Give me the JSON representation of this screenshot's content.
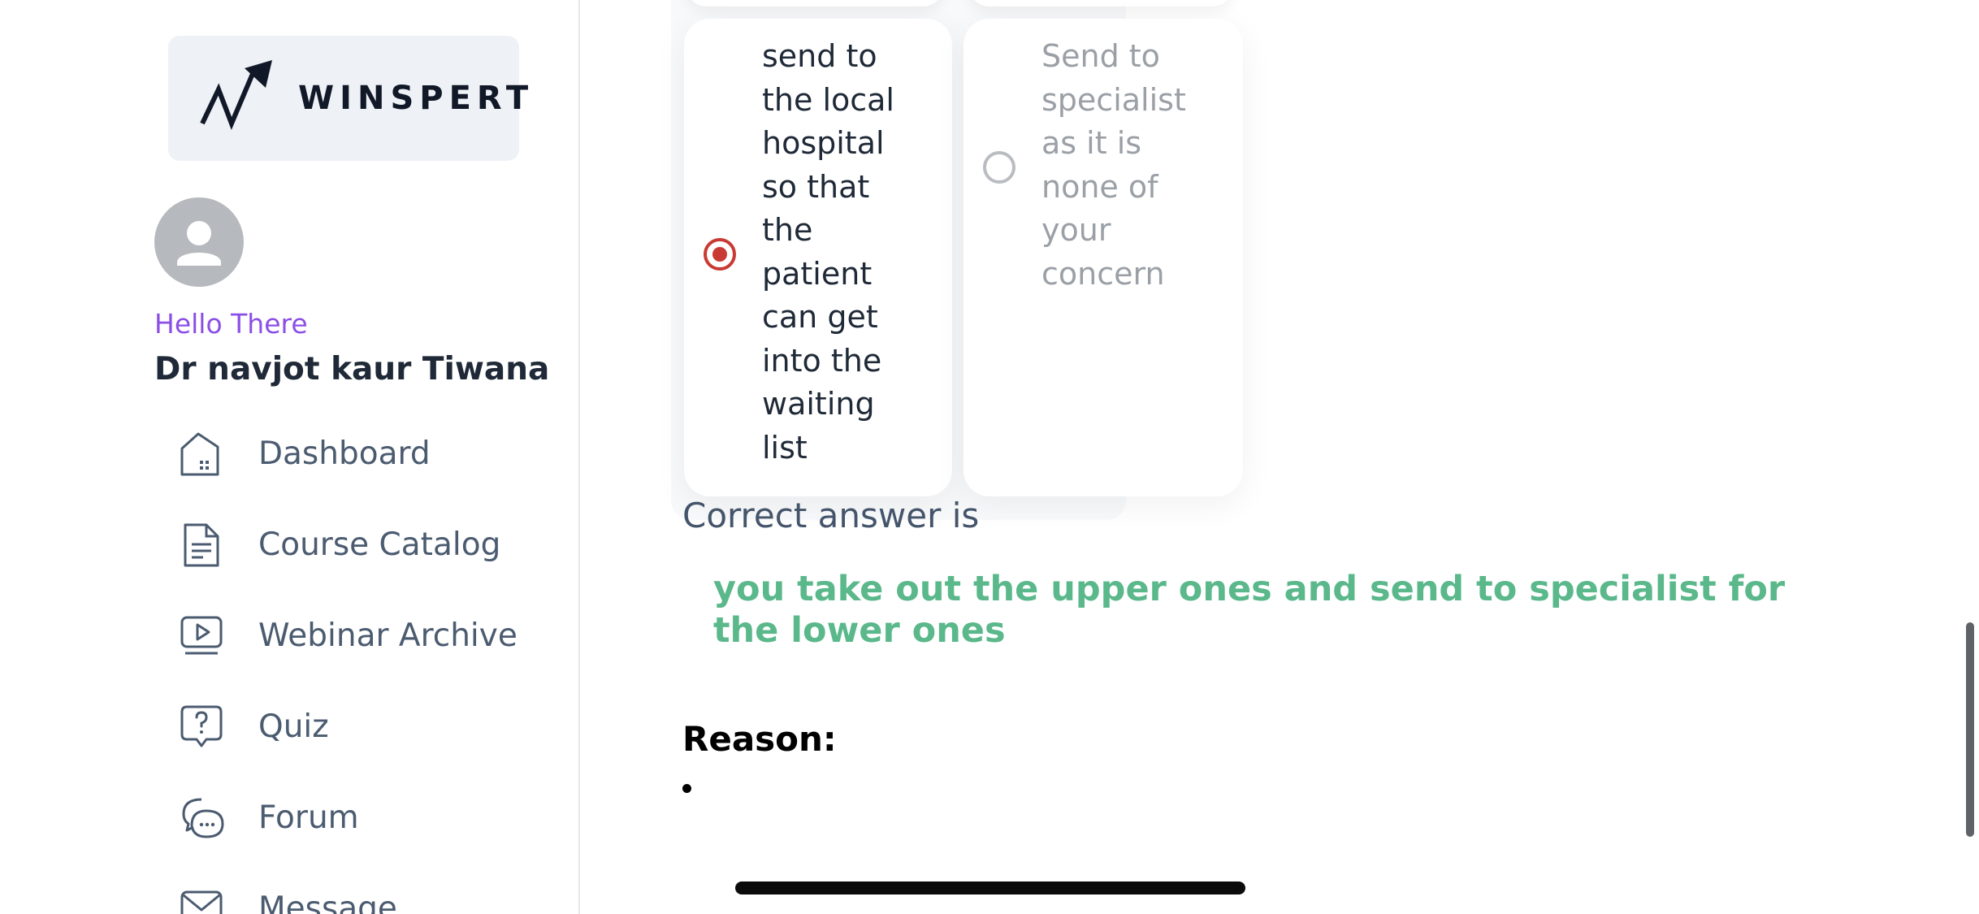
{
  "brand": {
    "logo_text": "WINSPERT"
  },
  "user": {
    "greeting": "Hello There",
    "name": "Dr navjot kaur Tiwana",
    "avatar_icon": "person-icon"
  },
  "sidebar": {
    "items": [
      {
        "label": "Dashboard",
        "icon": "home-icon"
      },
      {
        "label": "Course Catalog",
        "icon": "document-icon"
      },
      {
        "label": "Webinar Archive",
        "icon": "video-play-icon"
      },
      {
        "label": "Quiz",
        "icon": "question-bubble-icon"
      },
      {
        "label": "Forum",
        "icon": "chat-bubbles-icon"
      },
      {
        "label": "Message",
        "icon": "envelope-icon"
      }
    ]
  },
  "quiz": {
    "options": [
      {
        "text": "send to\nthe local\nhospital\nso that\nthe\npatient\ncan get\ninto the\nwaiting\nlist",
        "selected": true
      },
      {
        "text": "Send to\nspecialist\nas it is\nnone of\nyour\nconcern",
        "selected": false
      }
    ],
    "correct_label": "Correct answer is",
    "correct_answer": "you take out the upper ones and send to specialist for the lower ones",
    "reason_label": "Reason:"
  },
  "colors": {
    "accent_selected": "#c83a33",
    "greeting": "#8b4fe6",
    "correct_answer": "#5ab88b",
    "nav_text": "#4b5b70"
  }
}
